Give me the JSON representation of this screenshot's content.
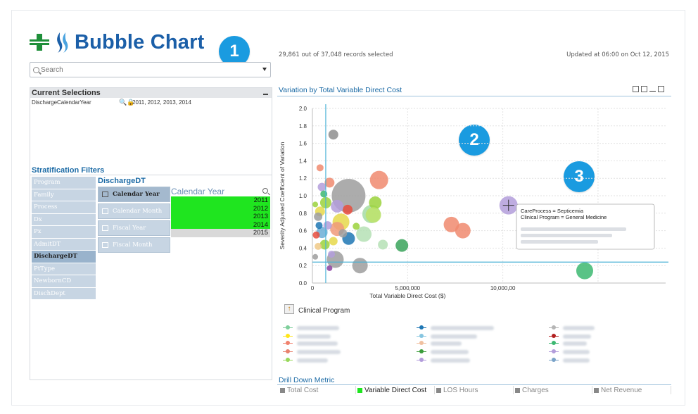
{
  "header": {
    "title": "Bubble Chart",
    "records_selected": "29,861 out of 37,048 records selected",
    "updated": "Updated at 06:00 on Oct 12, 2015"
  },
  "callouts": [
    "1",
    "2",
    "3"
  ],
  "search": {
    "placeholder": "Search"
  },
  "current_selections": {
    "title": "Current Selections",
    "field": "DischargeCalendarYear",
    "values": "2011, 2012, 2013, 2014"
  },
  "stratification": {
    "title": "Stratification Filters",
    "items": [
      "Program",
      "Family",
      "Process",
      "Dx",
      "Px",
      "AdmitDT",
      "DischargeDT",
      "PtType",
      "NewbornCD",
      "DischDept"
    ],
    "active": "DischargeDT"
  },
  "discharge_dt": {
    "title": "DischargeDT",
    "items": [
      "Calendar Year",
      "Calendar Month",
      "Fiscal Year",
      "Fiscal Month"
    ],
    "active": "Calendar Year"
  },
  "calendar_year": {
    "title": "Calendar Year",
    "values": [
      {
        "label": "2011",
        "selected": true
      },
      {
        "label": "2012",
        "selected": true
      },
      {
        "label": "2013",
        "selected": true
      },
      {
        "label": "2014",
        "selected": true
      },
      {
        "label": "2015",
        "selected": false
      }
    ]
  },
  "chart": {
    "title": "Variation by Total Variable Direct Cost",
    "legend_title": "Clinical Program",
    "tooltip": [
      "CareProcess = Septicemia",
      "Clinical Program = General Medicine"
    ]
  },
  "chart_data": {
    "type": "scatter",
    "xlabel": "Total Variable Direct Cost ($)",
    "ylabel": "Severity Adjusted Coefficient of Variation",
    "xlim": [
      0,
      10000000
    ],
    "ylim": [
      0,
      2.0
    ],
    "x_ticks": [
      "0",
      "5,000,000",
      "10,000,00"
    ],
    "y_ticks": [
      "0.0",
      "0.2",
      "0.4",
      "0.6",
      "0.8",
      "1.0",
      "1.2",
      "1.4",
      "1.6",
      "1.8",
      "2.0"
    ],
    "reference_lines": {
      "x": 700000,
      "y": 0.24
    },
    "points": [
      {
        "x": 1900000,
        "y": 1.0,
        "size": 24,
        "color": "#9e9e9e"
      },
      {
        "x": 1100000,
        "y": 1.7,
        "size": 7,
        "color": "#8e8e8e"
      },
      {
        "x": 3500000,
        "y": 1.18,
        "size": 13,
        "color": "#f08a6e"
      },
      {
        "x": 3100000,
        "y": 0.79,
        "size": 13,
        "color": "#a5dca5"
      },
      {
        "x": 3300000,
        "y": 0.92,
        "size": 9,
        "color": "#9bd23c"
      },
      {
        "x": 3200000,
        "y": 0.78,
        "size": 11,
        "color": "#bde36a"
      },
      {
        "x": 2700000,
        "y": 0.56,
        "size": 11,
        "color": "#b5e0b5"
      },
      {
        "x": 1900000,
        "y": 0.51,
        "size": 9,
        "color": "#1f77b4"
      },
      {
        "x": 1850000,
        "y": 0.84,
        "size": 7,
        "color": "#e84c3d"
      },
      {
        "x": 1500000,
        "y": 0.7,
        "size": 12,
        "color": "#e6d84a"
      },
      {
        "x": 1300000,
        "y": 0.62,
        "size": 10,
        "color": "#f09a7a"
      },
      {
        "x": 1200000,
        "y": 0.27,
        "size": 12,
        "color": "#9e9e9e"
      },
      {
        "x": 2500000,
        "y": 0.2,
        "size": 11,
        "color": "#9e9e9e"
      },
      {
        "x": 3700000,
        "y": 0.44,
        "size": 7,
        "color": "#b5e0b5"
      },
      {
        "x": 4700000,
        "y": 0.43,
        "size": 9,
        "color": "#3aa35a"
      },
      {
        "x": 7300000,
        "y": 0.67,
        "size": 11,
        "color": "#f08a6e"
      },
      {
        "x": 7900000,
        "y": 0.6,
        "size": 11,
        "color": "#f08a6e"
      },
      {
        "x": 10300000,
        "y": 0.89,
        "size": 13,
        "color": "#b39ddb"
      },
      {
        "x": 14300000,
        "y": 0.14,
        "size": 12,
        "color": "#3cb871"
      },
      {
        "x": 400000,
        "y": 1.32,
        "size": 5,
        "color": "#f08a6e"
      },
      {
        "x": 500000,
        "y": 1.1,
        "size": 6,
        "color": "#b39ddb"
      },
      {
        "x": 900000,
        "y": 1.15,
        "size": 7,
        "color": "#f08a6e"
      },
      {
        "x": 700000,
        "y": 0.92,
        "size": 8,
        "color": "#9bd23c"
      },
      {
        "x": 400000,
        "y": 0.82,
        "size": 7,
        "color": "#e6d84a"
      },
      {
        "x": 300000,
        "y": 0.76,
        "size": 6,
        "color": "#9e9e9e"
      },
      {
        "x": 500000,
        "y": 0.58,
        "size": 8,
        "color": "#6baed6"
      },
      {
        "x": 200000,
        "y": 0.55,
        "size": 5,
        "color": "#e84c3d"
      },
      {
        "x": 800000,
        "y": 0.66,
        "size": 6,
        "color": "#b39ddb"
      },
      {
        "x": 650000,
        "y": 0.44,
        "size": 7,
        "color": "#9bd23c"
      },
      {
        "x": 300000,
        "y": 0.42,
        "size": 5,
        "color": "#f0c987"
      },
      {
        "x": 1000000,
        "y": 0.33,
        "size": 5,
        "color": "#b39ddb"
      },
      {
        "x": 900000,
        "y": 0.17,
        "size": 4,
        "color": "#8b3fa0"
      },
      {
        "x": 1300000,
        "y": 0.88,
        "size": 9,
        "color": "#b39ddb"
      },
      {
        "x": 600000,
        "y": 1.02,
        "size": 5,
        "color": "#3cb871"
      },
      {
        "x": 1100000,
        "y": 0.48,
        "size": 6,
        "color": "#e6d84a"
      },
      {
        "x": 350000,
        "y": 0.66,
        "size": 5,
        "color": "#1f77b4"
      },
      {
        "x": 1600000,
        "y": 0.57,
        "size": 6,
        "color": "#9e9e9e"
      },
      {
        "x": 2300000,
        "y": 0.65,
        "size": 5,
        "color": "#9bd23c"
      },
      {
        "x": 150000,
        "y": 0.9,
        "size": 4,
        "color": "#9bd23c"
      },
      {
        "x": 150000,
        "y": 0.3,
        "size": 4,
        "color": "#9e9e9e"
      }
    ]
  },
  "legend": {
    "items": [
      {
        "color": "#7fcf9b"
      },
      {
        "color": "#ffe51a"
      },
      {
        "color": "#f0826e"
      },
      {
        "color": "#e8826e"
      },
      {
        "color": "#98d85a"
      },
      {
        "color": "#1f77b4"
      },
      {
        "color": "#86c5e0"
      },
      {
        "color": "#f0c0a0"
      },
      {
        "color": "#3a9c3a"
      },
      {
        "color": "#b39ddb"
      },
      {
        "color": "#b5b5b5"
      },
      {
        "color": "#b22020"
      },
      {
        "color": "#3cb871"
      },
      {
        "color": "#b39ddb"
      },
      {
        "color": "#7aa3c8"
      }
    ]
  },
  "drill_down": {
    "title": "Drill Down Metric",
    "items": [
      "Total Cost",
      "Variable Direct Cost",
      "LOS Hours",
      "Charges",
      "Net Revenue"
    ],
    "active": "Variable Direct Cost"
  }
}
